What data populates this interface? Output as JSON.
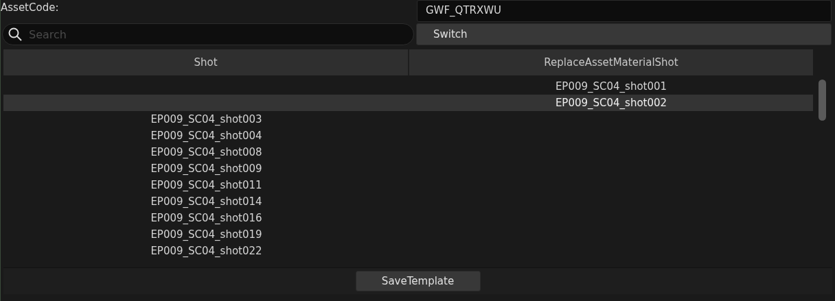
{
  "asset_code": {
    "label": "AssetCode:",
    "value": "GWF_QTRXWU"
  },
  "search": {
    "placeholder": "Search"
  },
  "switch_button": "Switch",
  "table": {
    "columns": [
      "Shot",
      "ReplaceAssetMaterialShot"
    ],
    "rows": [
      {
        "replace": "EP009_SC04_shot001",
        "selected": false
      },
      {
        "replace": "EP009_SC04_shot002",
        "selected": true
      },
      {
        "shot": "EP009_SC04_shot003",
        "selected": false
      },
      {
        "shot": "EP009_SC04_shot004",
        "selected": false
      },
      {
        "shot": "EP009_SC04_shot008",
        "selected": false
      },
      {
        "shot": "EP009_SC04_shot009",
        "selected": false
      },
      {
        "shot": "EP009_SC04_shot011",
        "selected": false
      },
      {
        "shot": "EP009_SC04_shot014",
        "selected": false
      },
      {
        "shot": "EP009_SC04_shot016",
        "selected": false
      },
      {
        "shot": "EP009_SC04_shot019",
        "selected": false
      },
      {
        "shot": "EP009_SC04_shot022",
        "selected": false
      }
    ]
  },
  "save_button": "SaveTemplate"
}
